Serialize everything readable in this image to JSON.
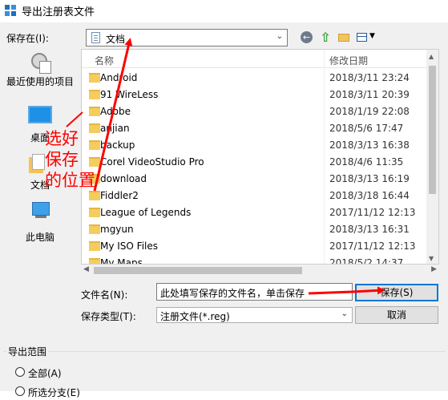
{
  "window": {
    "title": "导出注册表文件"
  },
  "toolbar": {
    "save_in_label": "保存在(I):",
    "save_in_value": "文档",
    "icons": [
      "back-icon",
      "up-folder-icon",
      "new-folder-icon",
      "view-menu-icon"
    ]
  },
  "places": [
    {
      "label": "最近使用的项目",
      "icon": "recent-items-icon"
    },
    {
      "label": "桌面",
      "icon": "desktop-icon"
    },
    {
      "label": "文档",
      "icon": "documents-icon"
    },
    {
      "label": "此电脑",
      "icon": "this-pc-icon"
    }
  ],
  "file_list": {
    "columns": [
      "名称",
      "修改日期"
    ],
    "rows": [
      {
        "name": "Android",
        "date": "2018/3/11 23:24"
      },
      {
        "name": "91 WireLess",
        "date": "2018/3/11 20:39"
      },
      {
        "name": "Adobe",
        "date": "2018/1/19 22:08"
      },
      {
        "name": "anjian",
        "date": "2018/5/6 17:47"
      },
      {
        "name": "backup",
        "date": "2018/3/13 16:38"
      },
      {
        "name": "Corel VideoStudio Pro",
        "date": "2018/4/6 11:35"
      },
      {
        "name": "download",
        "date": "2018/3/13 16:19"
      },
      {
        "name": "Fiddler2",
        "date": "2018/3/18 16:44"
      },
      {
        "name": "League of Legends",
        "date": "2017/11/12 12:13"
      },
      {
        "name": "mgyun",
        "date": "2018/3/13 16:31"
      },
      {
        "name": "My ISO Files",
        "date": "2017/11/12 12:13"
      },
      {
        "name": "My Maps",
        "date": "2018/5/2 14:37"
      }
    ]
  },
  "form": {
    "filename_label": "文件名(N):",
    "filename_value": "此处填写保存的文件名，单击保存",
    "filetype_label": "保存类型(T):",
    "filetype_value": "注册文件(*.reg)",
    "save_label": "保存(S)",
    "cancel_label": "取消"
  },
  "export_range": {
    "label": "导出范围",
    "options": [
      {
        "label": "全部(A)",
        "selected": false
      },
      {
        "label": "所选分支(E)",
        "selected": false
      }
    ]
  },
  "annotation": {
    "text_lines": [
      "选好",
      "保存",
      "的位置"
    ],
    "color": "#ff0000"
  },
  "colors": {
    "accent": "#0078d7",
    "annotation": "#ff0000",
    "folder": "#f5cd5e"
  }
}
